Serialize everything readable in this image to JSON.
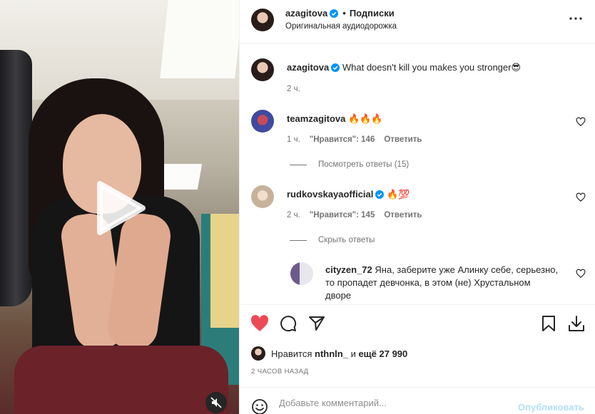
{
  "post": {
    "author": "azagitova",
    "follow_label": "Подписки",
    "dot": "•",
    "audio": "Оригинальная аудиодорожка",
    "caption": "What doesn't kill you makes you stronger😎",
    "caption_time": "2 ч."
  },
  "comments": [
    {
      "username": "teamzagitova",
      "text": "🔥🔥🔥",
      "time": "1 ч.",
      "likes_label": "\"Нравится\": 146",
      "reply_label": "Ответить",
      "replies_toggle": "Посмотреть ответы (15)"
    },
    {
      "username": "rudkovskayaofficial",
      "text": "🔥💯",
      "time": "2 ч.",
      "likes_label": "\"Нравится\": 145",
      "reply_label": "Ответить",
      "replies_toggle": "Скрыть ответы",
      "reply": {
        "username": "cityzen_72",
        "text_line1": "Яна, заберите уже Алинку себе, серьезно,",
        "text_line2": "то пропадет девчонка, в этом (не) Хрустальном",
        "text_line3": "дворе"
      }
    }
  ],
  "likes": {
    "prefix": "Нравится",
    "user": "nthnln_",
    "middle": "и",
    "rest": "ещё 27 990"
  },
  "timestamp": "2 ЧАСОВ НАЗАД",
  "comment_input": {
    "placeholder": "Добавьте комментарий...",
    "post_label": "Опубликовать"
  },
  "colors": {
    "like_red": "#ed4956",
    "verified_blue": "#0095f6",
    "post_disabled": "#b2dffc"
  },
  "icons": [
    "play-icon",
    "muted-icon",
    "more-icon",
    "verified-icon",
    "heart-icon",
    "comment-icon",
    "share-icon",
    "bookmark-icon",
    "download-icon",
    "emoji-icon"
  ]
}
